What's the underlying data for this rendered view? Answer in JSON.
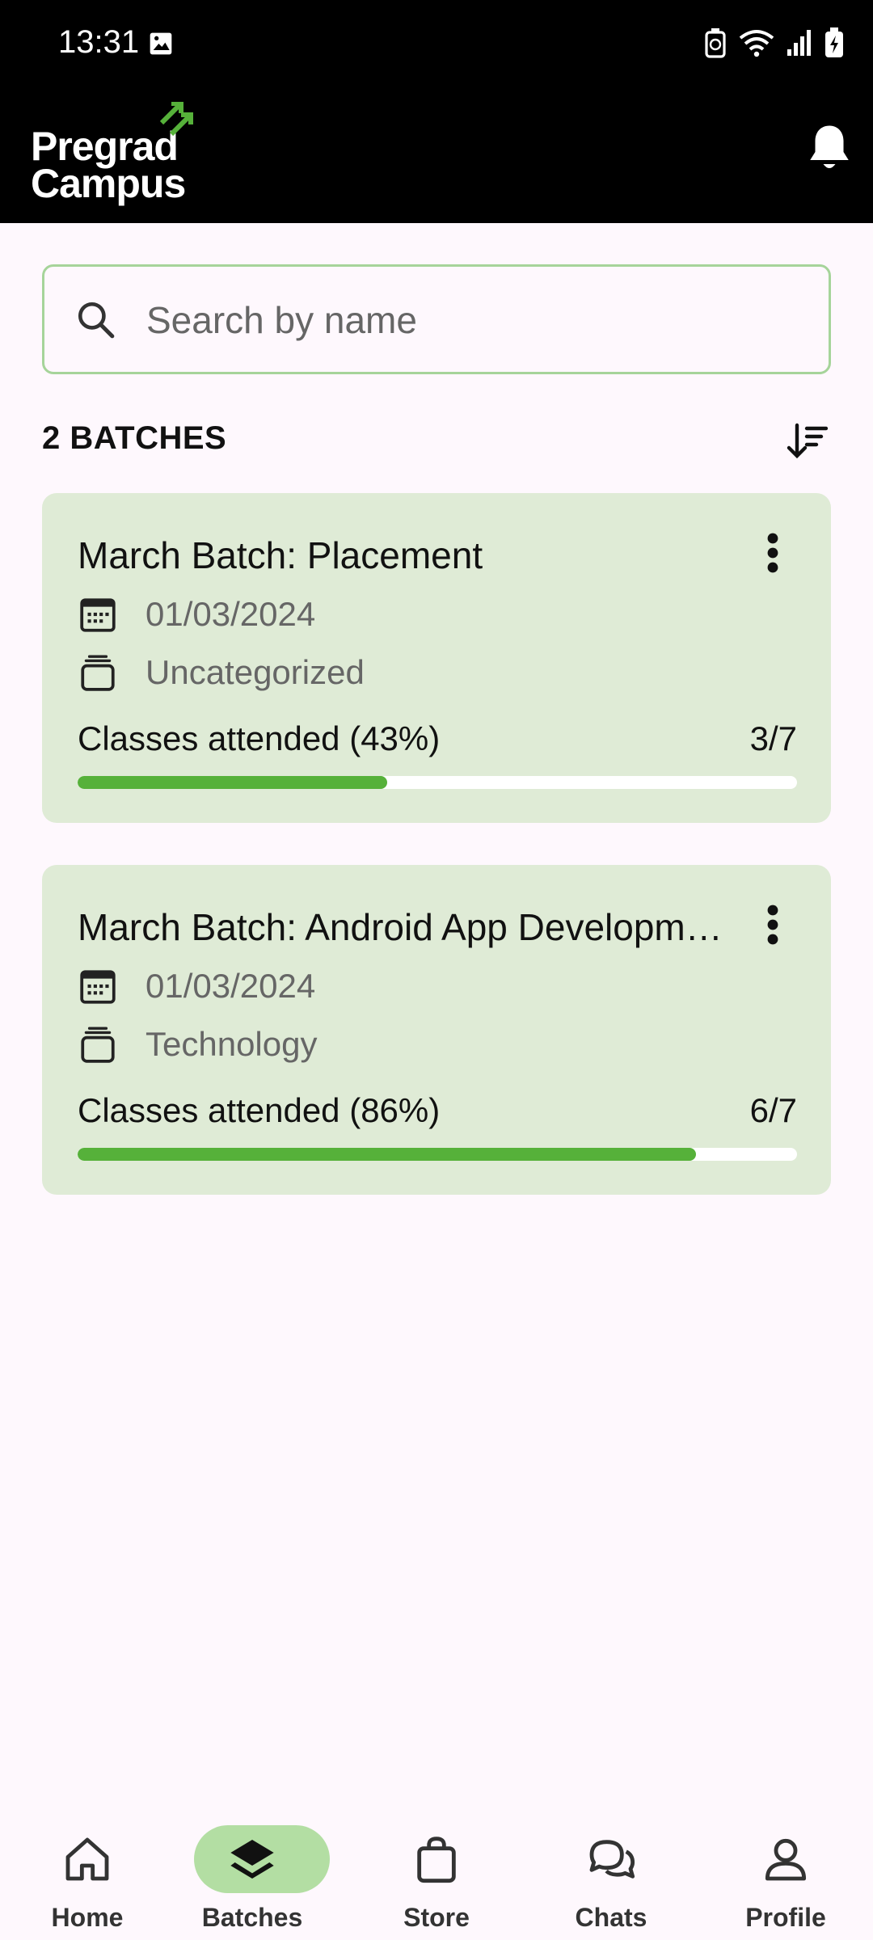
{
  "status_bar": {
    "time": "13:31"
  },
  "app": {
    "logo_line1": "Pregrad",
    "logo_line2": "Campus",
    "accent": "#56b13a"
  },
  "search": {
    "placeholder": "Search by name"
  },
  "batches": {
    "count_label": "2 BATCHES",
    "items": [
      {
        "title": "March Batch: Placement",
        "date": "01/03/2024",
        "category": "Uncategorized",
        "attendance_label": "Classes attended (43%)",
        "attendance_count": "3/7",
        "progress": 0.43
      },
      {
        "title": "March Batch: Android App Developm…",
        "date": "01/03/2024",
        "category": "Technology",
        "attendance_label": "Classes attended (86%)",
        "attendance_count": "6/7",
        "progress": 0.86
      }
    ]
  },
  "nav": {
    "active": "Batches",
    "active_color": "#b3dea3",
    "items": [
      {
        "label": "Home",
        "icon": "home-icon"
      },
      {
        "label": "Batches",
        "icon": "layers-icon"
      },
      {
        "label": "Store",
        "icon": "bag-icon"
      },
      {
        "label": "Chats",
        "icon": "chat-icon"
      },
      {
        "label": "Profile",
        "icon": "person-icon"
      }
    ]
  }
}
